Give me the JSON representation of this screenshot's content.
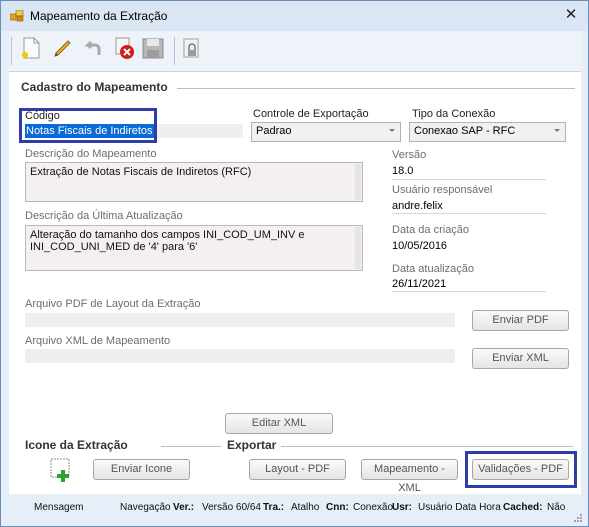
{
  "window": {
    "title": "Mapeamento da Extração",
    "close_glyph": "✕"
  },
  "toolbar": {
    "buttons": [
      {
        "name": "new-document-icon"
      },
      {
        "name": "edit-pencil-icon"
      },
      {
        "name": "undo-arrow-icon"
      },
      {
        "name": "delete-icon"
      },
      {
        "name": "save-disk-icon"
      },
      {
        "name": "lock-icon"
      }
    ]
  },
  "cadastro": {
    "group_title": "Cadastro do Mapeamento",
    "codigo_label": "Código",
    "codigo_value": "Notas Fiscais de Indiretos",
    "controle_label": "Controle de Exportação",
    "controle_value": "Padrao",
    "tipo_label": "Tipo da Conexão",
    "tipo_value": "Conexao SAP - RFC",
    "descricao_label": "Descrição do Mapeamento",
    "descricao_value": "Extração de Notas Fiscais de Indiretos (RFC)",
    "versao_label": "Versão",
    "versao_value": "18.0",
    "usuario_label": "Usuário responsável",
    "usuario_value": "andre.felix",
    "ultima_label": "Descrição da Última Atualização",
    "ultima_value": "Alteração do tamanho dos campos INI_COD_UM_INV e INI_COD_UNI_MED de '4' para '6'",
    "data_criacao_label": "Data da criação",
    "data_criacao_value": "10/05/2016",
    "data_atualizacao_label": "Data atualização",
    "data_atualizacao_value": "26/11/2021",
    "pdf_label": "Arquivo PDF de Layout da Extração",
    "enviar_pdf": "Enviar PDF",
    "xml_label": "Arquivo XML de Mapeamento",
    "enviar_xml": "Enviar XML",
    "editar_xml": "Editar XML"
  },
  "icone": {
    "group_title": "Icone da Extração",
    "enviar_icone": "Enviar Icone"
  },
  "exportar": {
    "group_title": "Exportar",
    "layout_pdf": "Layout - PDF",
    "mapeamento_xml": "Mapeamento - XML",
    "validacoes_pdf": "Validações - PDF"
  },
  "status": {
    "mensagem": "Mensagem",
    "navegacao": "Navegação",
    "ver_label": "Ver.:",
    "ver_value": "Versão 60/64",
    "tra_label": "Tra.:",
    "tra_value": "Atalho",
    "cnn_label": "Cnn:",
    "cnn_value": "Conexão",
    "usr_label": "Usr:",
    "usr_value": "Usuário Data Hora",
    "cached_label": "Cached:",
    "cached_value": "Não"
  },
  "colors": {
    "highlight_border": "#2e3ea6",
    "selection": "#0a6ad6",
    "window_bg": "#e6eef8"
  }
}
